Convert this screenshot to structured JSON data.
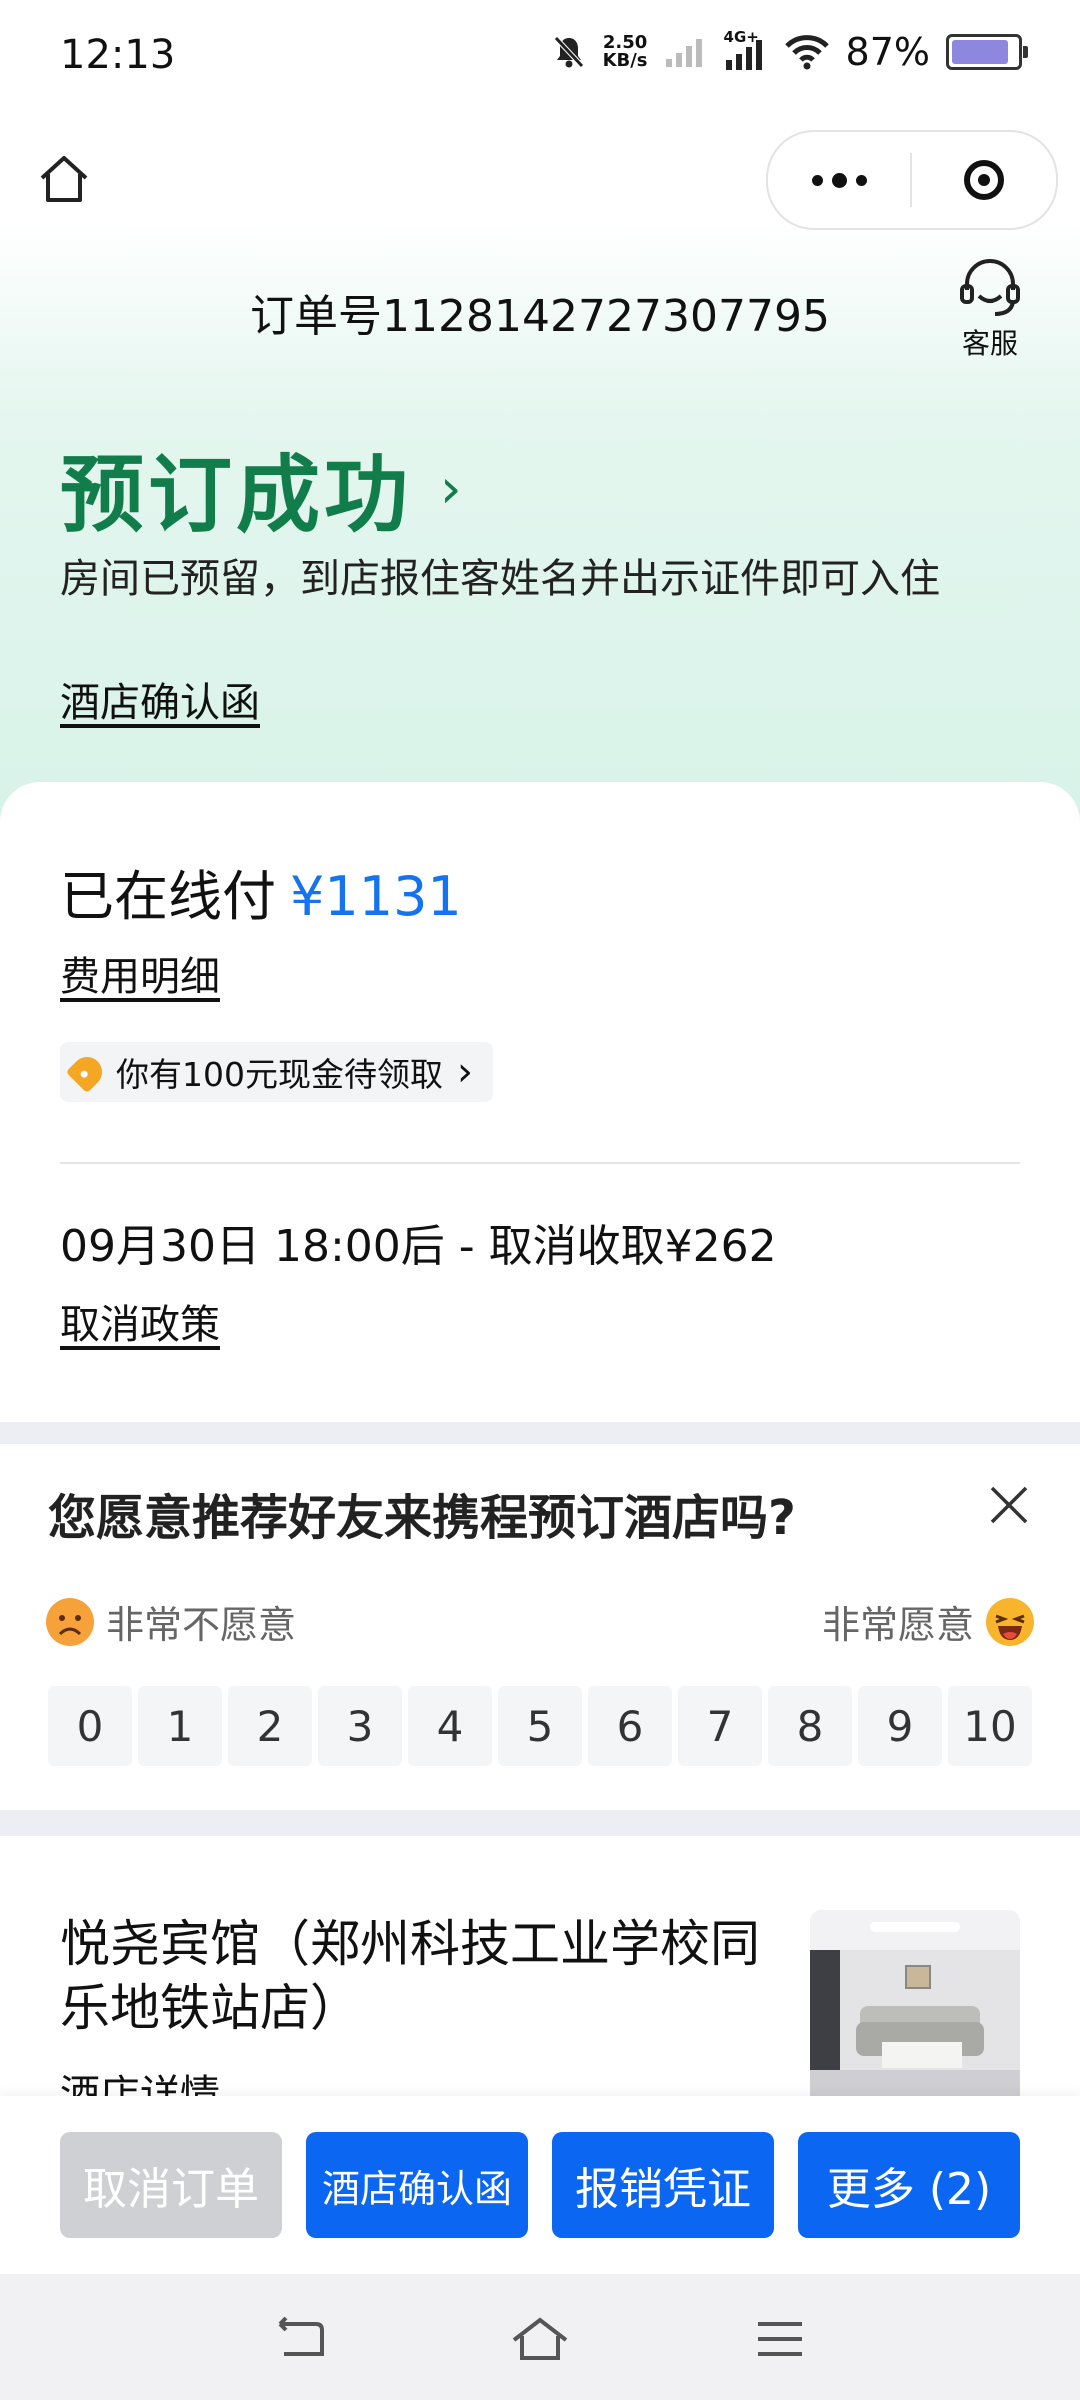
{
  "status_bar": {
    "time": "12:13",
    "speed_value": "2.50",
    "speed_unit": "KB/s",
    "network": "4G+",
    "battery": "87%"
  },
  "header": {
    "order_number": "订单号1128142727307795",
    "service_label": "客服"
  },
  "status": {
    "title": "预订成功",
    "description": "房间已预留，到店报住客姓名并出示证件即可入住",
    "confirm_link": "酒店确认函"
  },
  "payment": {
    "paid_label": "已在线付",
    "amount": "¥1131",
    "fee_detail_link": "费用明细",
    "coupon_text": "你有100元现金待领取",
    "cancel_info": "09月30日 18:00后 - 取消收取¥262",
    "cancel_policy_link": "取消政策"
  },
  "survey": {
    "question": "您愿意推荐好友来携程预订酒店吗?",
    "low_label": "非常不愿意",
    "high_label": "非常愿意",
    "scale": [
      "0",
      "1",
      "2",
      "3",
      "4",
      "5",
      "6",
      "7",
      "8",
      "9",
      "10"
    ]
  },
  "hotel": {
    "name": "悦尧宾馆（郑州科技工业学校同乐地铁站店）",
    "detail_link": "酒店详情"
  },
  "actions": {
    "cancel_order": "取消订单",
    "confirmation_letter": "酒店确认函",
    "reimbursement": "报销凭证",
    "more": "更多 (2)"
  },
  "colors": {
    "success_green": "#117d4b",
    "amount_blue": "#1673f0",
    "button_blue": "#0b67f2",
    "disabled_gray": "#cfd0d3"
  }
}
